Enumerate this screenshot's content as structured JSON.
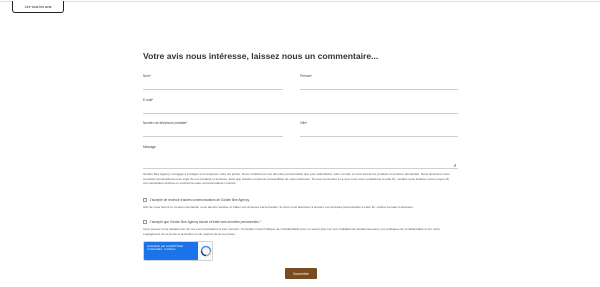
{
  "top": {
    "button_label": "Lire tous les avis"
  },
  "form": {
    "title": "Votre avis nous intéresse, laissez nous un commentaire...",
    "fields": {
      "nom": "Nom*",
      "prenom": "Prénom*",
      "email": "E-mail*",
      "telephone": "Numéro de téléphone portable*",
      "ville": "Ville*",
      "message": "Message"
    },
    "privacy_text": "Golden Bee Agency s'engage à protéger et à respecter votre vie privée. Nous n'utiliserons vos données personnelles que pour administrer votre compte et vous fournir les produits et services demandés. Nous aimerions vous contacter ponctuellement au sujet de nos produits et services, ainsi que d'autres contenus susceptibles de vous intéresser. Si vous consentez à ce que nous vous contactions à cette fin, veuillez nous indiquer votre moyen de communication préféré en cochant la case correspondante ci-après :",
    "checkbox1_label": "J'accepte de recevoir d'autres communications de Golden Bee Agency.",
    "storage_text": "Afin de vous fournir le contenu demandé, nous devons stocker et traiter vos données personnelles. Si vous nous autorisez à stocker vos données personnelles à cette fin, cochez la case ci-dessous.",
    "checkbox2_label": "J'accepte que Golden Bee Agency stocke et traite mes données personnelles *",
    "unsubscribe_text": "Vous pouvez vous désabonner de ces communications à tout moment. Consultez notre Politique de confidentialité pour en savoir plus sur nos modalités de désabonnement, nos politiques de confidentialité et sur notre engagement vis-à-vis de la protection et du respect de la vie privée.",
    "captcha": {
      "line1": "protection par reCAPTCHA",
      "line2": "Confidentialité - Conditions"
    },
    "submit_label": "Soumettre"
  },
  "colors": {
    "submit_bg": "#7a4a20",
    "captcha_blue": "#1a73e8"
  }
}
